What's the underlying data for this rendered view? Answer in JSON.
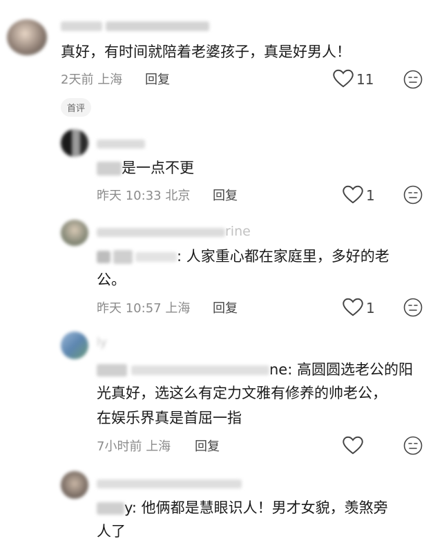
{
  "comments": [
    {
      "text": "真好，有时间就陪着老婆孩子，真是好男人！",
      "time": "2天前",
      "location": "上海",
      "reply_label": "回复",
      "likes": "11",
      "badge": "首评"
    },
    {
      "text_visible": "是一点不更",
      "time": "昨天 10:33",
      "location": "北京",
      "reply_label": "回复",
      "likes": "1"
    },
    {
      "name_visible": "rine",
      "text_visible_line1": ": 人家重心都在家庭里，多好的老",
      "text_line2": "公。",
      "time": "昨天 10:57",
      "location": "上海",
      "reply_label": "回复",
      "likes": "1"
    },
    {
      "name_visible": "ly",
      "text_visible_line1": "ne: 高圆圆选老公的阳",
      "text_line2": "光真好，选这么有定力文雅有修养的帅老公，",
      "text_line3": "在娱乐界真是首屈一指",
      "time": "7小时前",
      "location": "上海",
      "reply_label": "回复",
      "likes": ""
    },
    {
      "text_visible_line1": "y: 他俩都是慧眼识人！男才女貌，羡煞旁",
      "text_line2": "人了"
    }
  ],
  "icons": {
    "like": "heart-outline-icon",
    "emoji": "neutral-face-icon"
  },
  "colors": {
    "text": "#1a1a1a",
    "meta": "#8b8b8b",
    "icon": "#444444"
  }
}
